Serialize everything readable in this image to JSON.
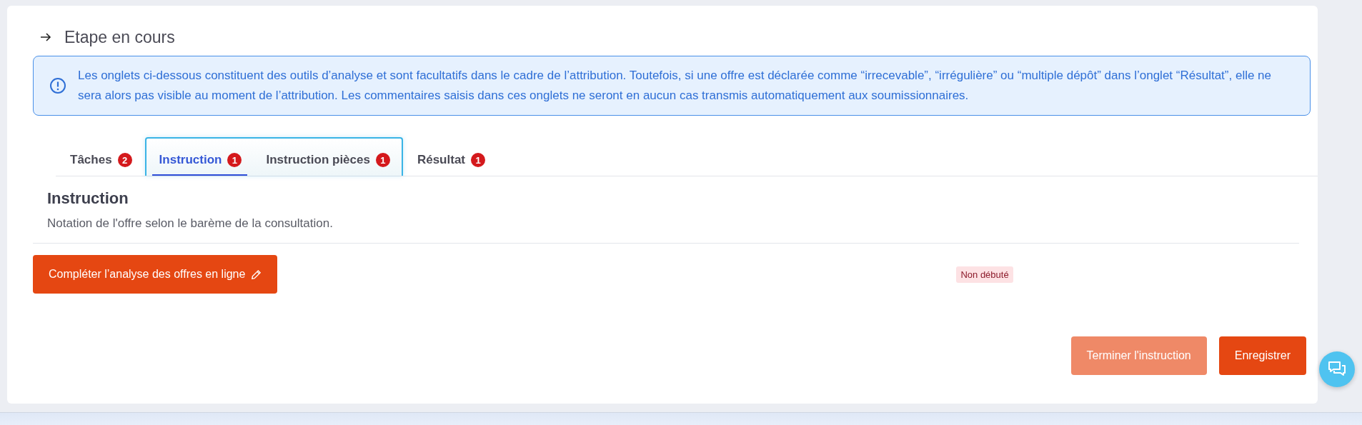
{
  "step": {
    "title": "Etape en cours"
  },
  "notice": {
    "text": "Les onglets ci-dessous constituent des outils d’analyse et sont facultatifs dans le cadre de l’attribution. Toutefois, si une offre est déclarée comme “irrecevable”, “irrégulière” ou “multiple dépôt” dans l’onglet “Résultat”, elle ne sera alors pas visible au moment de l’attribution. Les commentaires saisis dans ces onglets ne seront en aucun cas transmis automatiquement aux soumissionnaires."
  },
  "tabs": [
    {
      "label": "Tâches",
      "count": "2",
      "selected": false,
      "focused": false
    },
    {
      "label": "Instruction",
      "count": "1",
      "selected": true,
      "focused": true
    },
    {
      "label": "Instruction pièces",
      "count": "1",
      "selected": false,
      "focused": true
    },
    {
      "label": "Résultat",
      "count": "1",
      "selected": false,
      "focused": false
    }
  ],
  "section": {
    "title": "Instruction",
    "description": "Notation de l'offre selon le barème de la consultation."
  },
  "action": {
    "label": "Compléter l’analyse des offres en ligne",
    "status": "Non débuté"
  },
  "footer_buttons": [
    {
      "label": "Terminer l'instruction",
      "disabled": true
    },
    {
      "label": "Enregistrer",
      "disabled": false
    }
  ]
}
